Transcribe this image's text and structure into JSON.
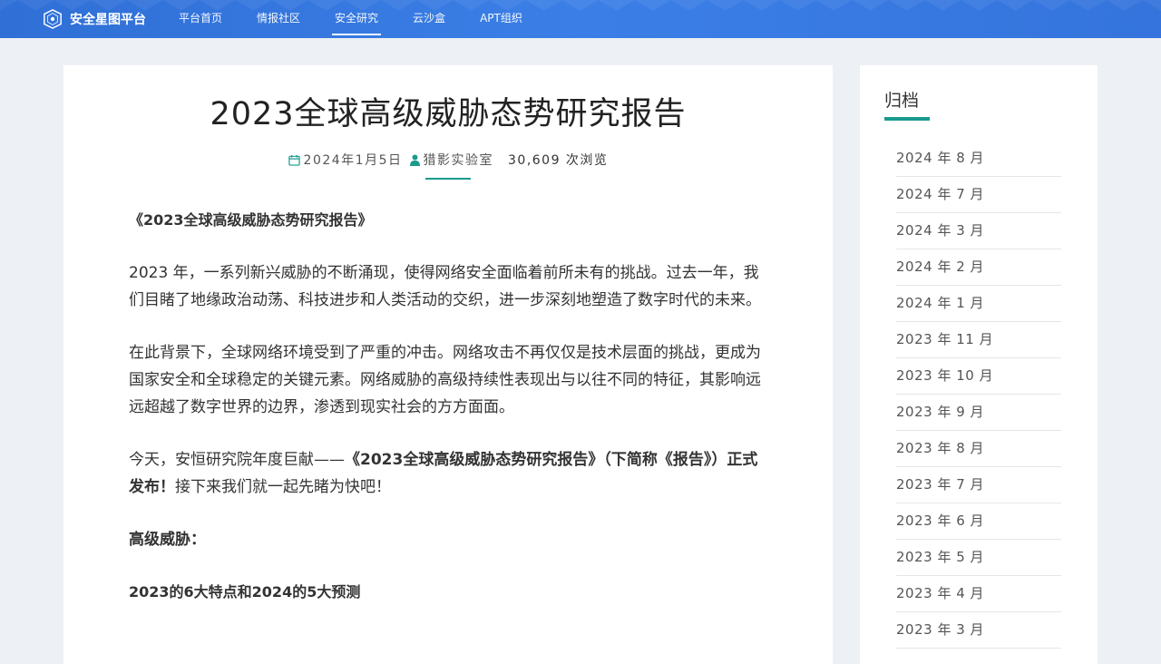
{
  "header": {
    "brand": "安全星图平台",
    "nav": [
      "平台首页",
      "情报社区",
      "安全研究",
      "云沙盒",
      "APT组织"
    ],
    "active_index": 2
  },
  "article": {
    "title": "2023全球高级威胁态势研究报告",
    "meta": {
      "date": "2024年1月5日",
      "author": "猎影实验室",
      "views": "30,609 次浏览"
    },
    "paragraphs": {
      "p1": "《2023全球高级威胁态势研究报告》",
      "p2": "2023 年，一系列新兴威胁的不断涌现，使得网络安全面临着前所未有的挑战。过去一年，我们目睹了地缘政治动荡、科技进步和人类活动的交织，进一步深刻地塑造了数字时代的未来。",
      "p3": "在此背景下，全球网络环境受到了严重的冲击。网络攻击不再仅仅是技术层面的挑战，更成为国家安全和全球稳定的关键元素。网络威胁的高级持续性表现出与以往不同的特征，其影响远远超越了数字世界的边界，渗透到现实社会的方方面面。",
      "p4_prefix": "今天，安恒研究院年度巨献——",
      "p4_bold": "《2023全球高级威胁态势研究报告》（下简称《报告》）正式发布！",
      "p4_suffix": "接下来我们就一起先睹为快吧！",
      "p5": "高级威胁：",
      "p6": "2023的6大特点和2024的5大预测"
    }
  },
  "sidebar": {
    "title": "归档",
    "items": [
      "2024 年 8 月",
      "2024 年 7 月",
      "2024 年 3 月",
      "2024 年 2 月",
      "2024 年 1 月",
      "2023 年 11 月",
      "2023 年 10 月",
      "2023 年 9 月",
      "2023 年 8 月",
      "2023 年 7 月",
      "2023 年 6 月",
      "2023 年 5 月",
      "2023 年 4 月",
      "2023 年 3 月"
    ]
  },
  "colors": {
    "header_blue": "#3474dc",
    "accent_teal": "#1a9a8c",
    "page_bg": "#edf0f4"
  },
  "icons": {
    "brand": "shield-logo-icon",
    "date": "calendar-icon",
    "author": "user-icon"
  }
}
